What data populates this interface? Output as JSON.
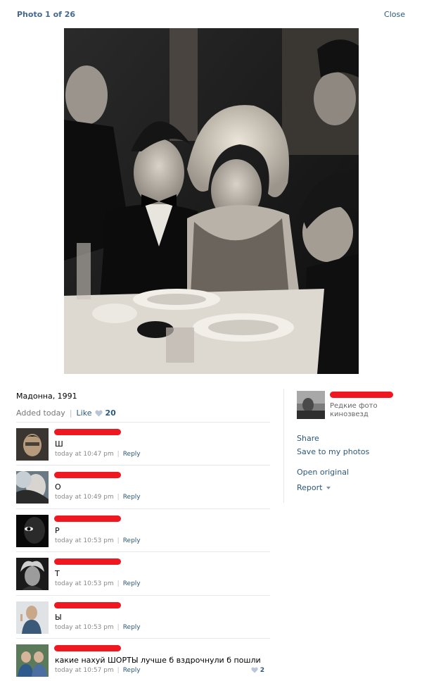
{
  "header": {
    "title": "Photo 1 of 26",
    "close_label": "Close"
  },
  "photo": {
    "caption": "Мадонна, 1991"
  },
  "meta": {
    "added": "Added today",
    "like_label": "Like",
    "like_count": "20"
  },
  "comments": [
    {
      "text": "Ш",
      "time": "today at 10:47 pm",
      "reply": "Reply"
    },
    {
      "text": "О",
      "time": "today at 10:49 pm",
      "reply": "Reply"
    },
    {
      "text": "Р",
      "time": "today at 10:53 pm",
      "reply": "Reply"
    },
    {
      "text": "Т",
      "time": "today at 10:53 pm",
      "reply": "Reply"
    },
    {
      "text": "Ы",
      "time": "today at 10:53 pm",
      "reply": "Reply"
    },
    {
      "text": "какие нахуй ШОРТЫ лучше б вздрочнули б пошли",
      "time": "today at 10:57 pm",
      "reply": "Reply",
      "likes": "2"
    }
  ],
  "sidebar": {
    "album_name": "Редкие фото кинозвезд",
    "share": "Share",
    "save": "Save to my photos",
    "open_original": "Open original",
    "report": "Report"
  },
  "colors": {
    "link": "#2b587a",
    "title": "#45688e",
    "redaction": "#f01820",
    "divider": "#e4e8ed"
  }
}
